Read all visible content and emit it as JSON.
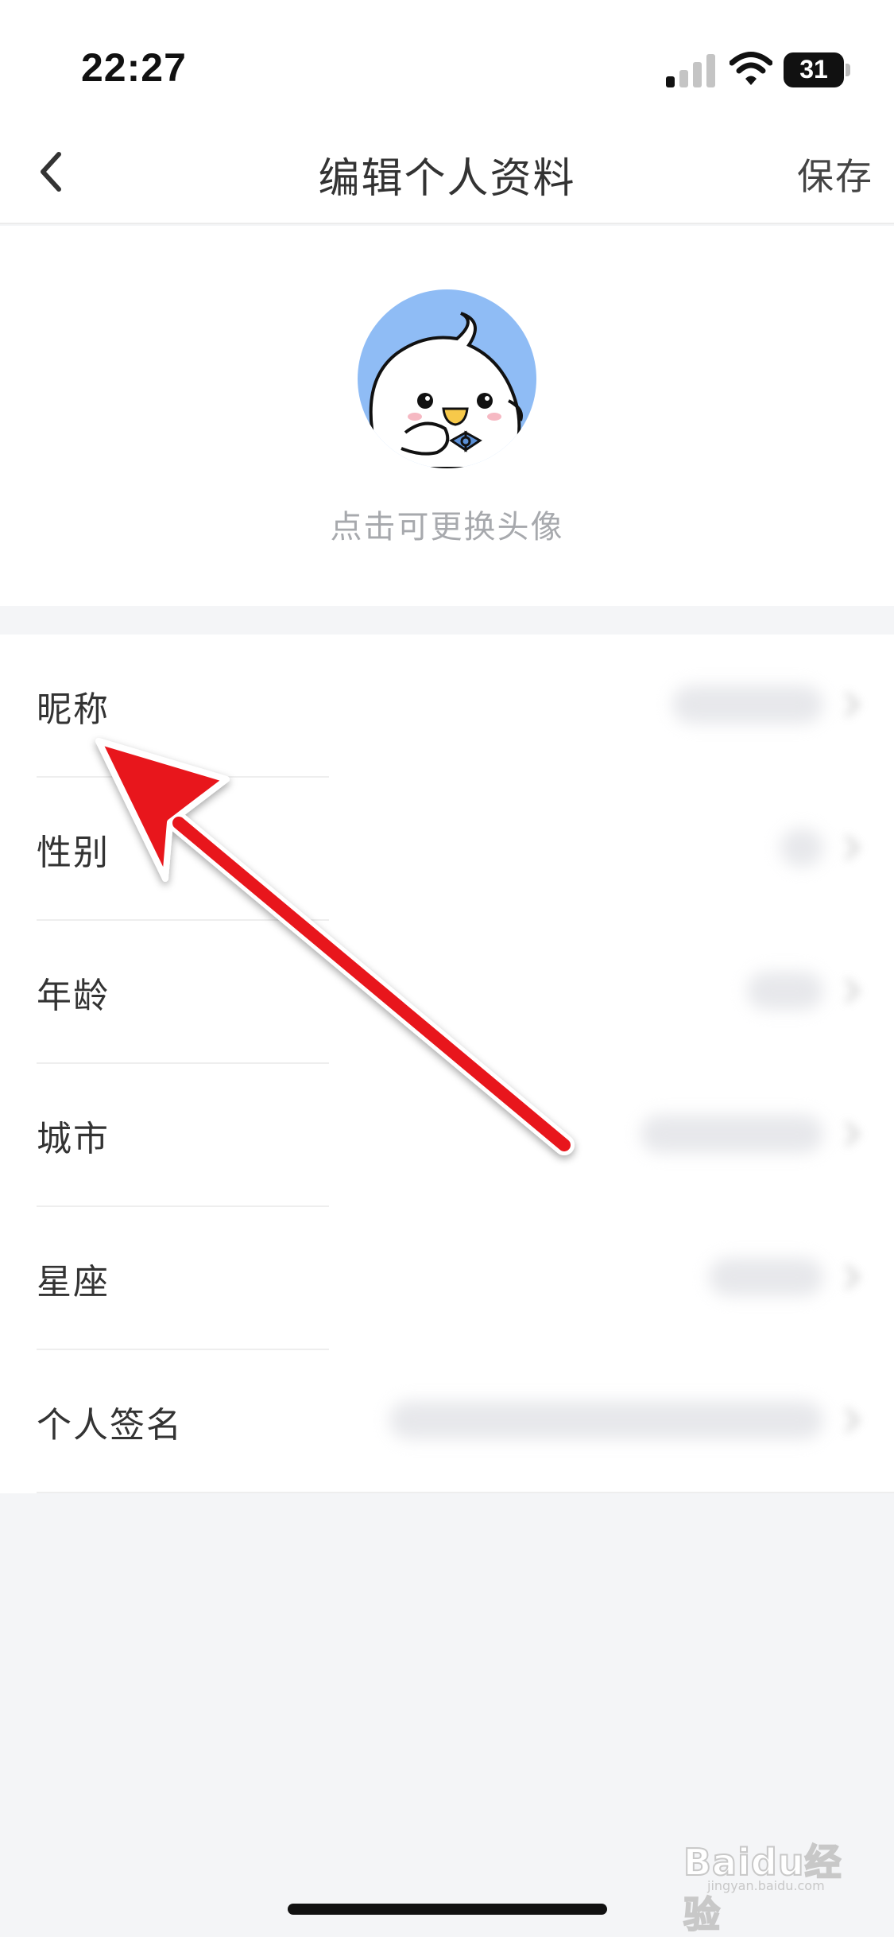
{
  "status_bar": {
    "time": "22:27",
    "battery": "31",
    "icons": [
      "signal-icon",
      "wifi-icon",
      "battery-icon"
    ]
  },
  "nav": {
    "back_icon": "chevron-left-icon",
    "title": "编辑个人资料",
    "save_label": "保存"
  },
  "avatar": {
    "icon": "duck-avatar",
    "hint": "点击可更换头像",
    "bg_color": "#8fbcf5"
  },
  "profile_fields": [
    {
      "label": "昵称"
    },
    {
      "label": "性别"
    },
    {
      "label": "年龄"
    },
    {
      "label": "城市"
    },
    {
      "label": "星座"
    },
    {
      "label": "个人签名"
    }
  ],
  "annotation": {
    "icon": "red-arrow-icon",
    "color": "#e8151b"
  },
  "watermark": {
    "brand": "Baidu经验",
    "url": "jingyan.baidu.com"
  }
}
